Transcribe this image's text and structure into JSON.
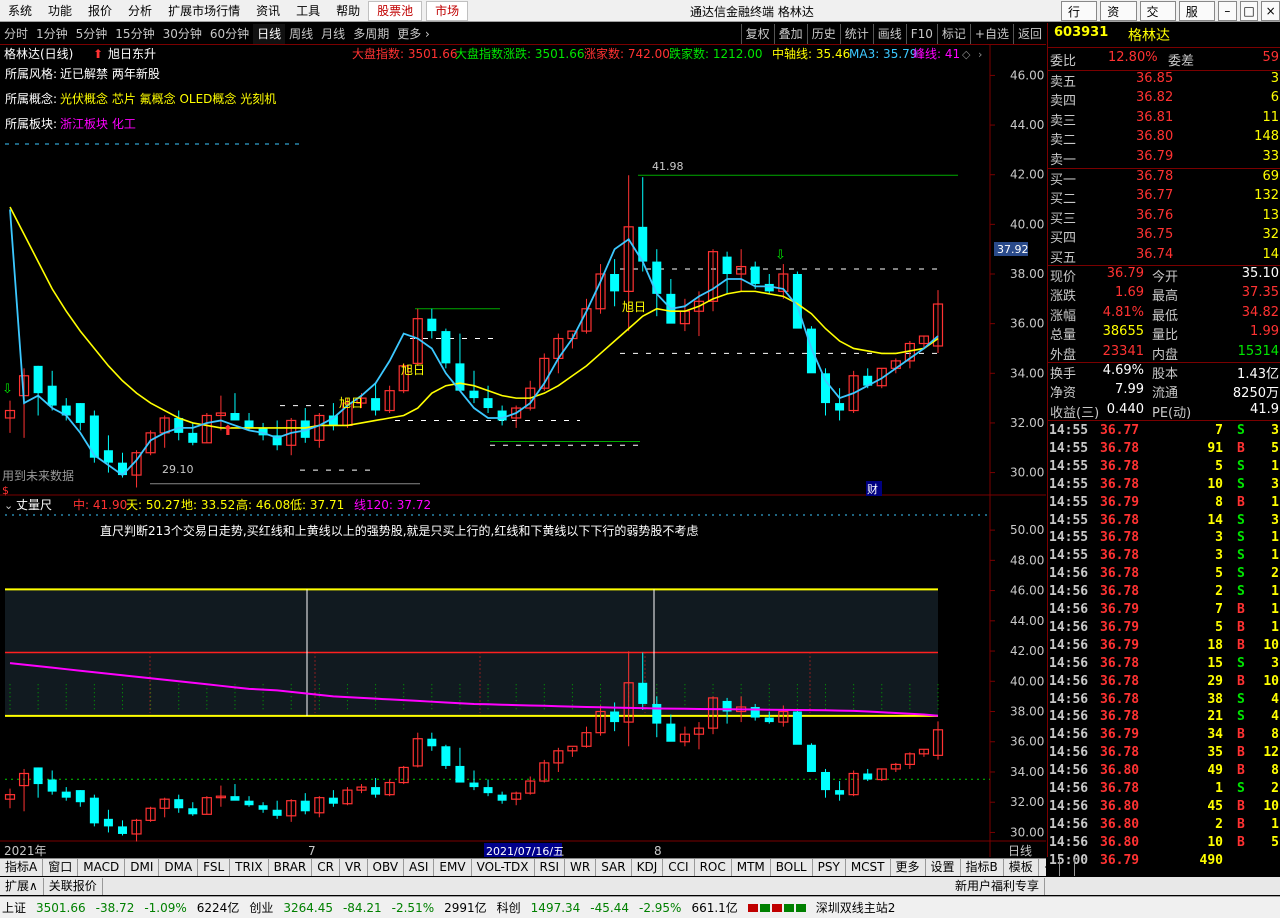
{
  "menu": {
    "items": [
      "系统",
      "功能",
      "报价",
      "分析",
      "扩展市场行情",
      "资讯",
      "工具",
      "帮助"
    ],
    "hl": [
      "股票池",
      "市场"
    ]
  },
  "app_title": "通达信金融终端  格林达",
  "win_buttons": [
    "行情",
    "资讯",
    "交易",
    "服务"
  ],
  "toolbar": {
    "periods": [
      "分时",
      "1分钟",
      "5分钟",
      "15分钟",
      "30分钟",
      "60分钟",
      "日线",
      "周线",
      "月线",
      "多周期",
      "更多 ›"
    ],
    "active": "日线",
    "actions": [
      "复权",
      "叠加",
      "历史",
      "统计",
      "画线",
      "F10",
      "标记",
      "+自选",
      "返回"
    ]
  },
  "main_info": {
    "title": "格林达(日线)",
    "signal": "旭日东升",
    "index_label": "大盘指数: 3501.66",
    "index_change_label": "大盘指数涨跌: 3501.66",
    "up_count_label": "涨家数: 742.00",
    "down_count_label": "跌家数: 1212.00",
    "mid_axis_label": "中轴线: 35.46",
    "ma3_label": "MA3: 35.79",
    "peak_label": "峰线: 41",
    "style_label": "所属风格:",
    "style_value": "近已解禁 两年新股",
    "concept_label": "所属概念:",
    "concept_value": "光伏概念 芯片 氟概念 OLED概念 光刻机",
    "sector_label": "所属板块:",
    "sector_value": "浙江板块 化工",
    "future_data": "用到未来数据",
    "high_mark": "41.98",
    "low_mark": "29.10",
    "xuri_label": "旭日",
    "cai_label": "财",
    "price_tag": "37.92"
  },
  "sub_info": {
    "title": "丈量尺",
    "zhong": "中: 41.90",
    "tian": "天: 50.27",
    "di": "地: 33.52",
    "gao": "高: 46.08",
    "di2": "低: 37.71",
    "xian120": "线120: 37.72",
    "desc": "直尺判断213个交易日走势,买红线和上黄线以上的强势股,就是只买上行的,红线和下黄线以下下行的弱势股不考虑"
  },
  "x_labels": [
    "2021年",
    "7",
    "8"
  ],
  "x_cursor_date": "2021/07/16/五",
  "y_axis_main": [
    "46.00",
    "44.00",
    "42.00",
    "40.00",
    "38.00",
    "36.00",
    "34.00",
    "32.00",
    "30.00"
  ],
  "y_axis_sub": [
    "50.00",
    "48.00",
    "46.00",
    "44.00",
    "42.00",
    "40.00",
    "38.00",
    "36.00",
    "34.00",
    "32.00",
    "30.00"
  ],
  "y_axis_unit": "日线",
  "right_panel": {
    "code": "603931",
    "name": "格林达",
    "weibi_label": "委比",
    "weibi": "12.80%",
    "weicha_label": "委差",
    "weicha": "59",
    "asks": [
      {
        "label": "卖五",
        "price": "36.85",
        "vol": "3"
      },
      {
        "label": "卖四",
        "price": "36.82",
        "vol": "6"
      },
      {
        "label": "卖三",
        "price": "36.81",
        "vol": "11"
      },
      {
        "label": "卖二",
        "price": "36.80",
        "vol": "148"
      },
      {
        "label": "卖一",
        "price": "36.79",
        "vol": "33"
      }
    ],
    "bids": [
      {
        "label": "买一",
        "price": "36.78",
        "vol": "69"
      },
      {
        "label": "买二",
        "price": "36.77",
        "vol": "132"
      },
      {
        "label": "买三",
        "price": "36.76",
        "vol": "13"
      },
      {
        "label": "买四",
        "price": "36.75",
        "vol": "32"
      },
      {
        "label": "买五",
        "price": "36.74",
        "vol": "14"
      }
    ],
    "stats1": [
      {
        "l1": "现价",
        "v1": "36.79",
        "c1": "red",
        "l2": "今开",
        "v2": "35.10",
        "c2": "white"
      },
      {
        "l1": "涨跌",
        "v1": "1.69",
        "c1": "red",
        "l2": "最高",
        "v2": "37.35",
        "c2": "red"
      },
      {
        "l1": "涨幅",
        "v1": "4.81%",
        "c1": "red",
        "l2": "最低",
        "v2": "34.82",
        "c2": "red"
      },
      {
        "l1": "总量",
        "v1": "38655",
        "c1": "yellow",
        "l2": "量比",
        "v2": "1.99",
        "c2": "red"
      },
      {
        "l1": "外盘",
        "v1": "23341",
        "c1": "red",
        "l2": "内盘",
        "v2": "15314",
        "c2": "green"
      }
    ],
    "stats2": [
      {
        "l1": "换手",
        "v1": "4.69%",
        "l2": "股本",
        "v2": "1.43亿"
      },
      {
        "l1": "净资",
        "v1": "7.99",
        "l2": "流通",
        "v2": "8250万"
      },
      {
        "l1": "收益(三)",
        "v1": "0.440",
        "l2": "PE(动)",
        "v2": "41.9"
      }
    ],
    "ticks": [
      {
        "t": "14:55",
        "p": "36.77",
        "v": "7",
        "s": "S",
        "n": "3"
      },
      {
        "t": "14:55",
        "p": "36.78",
        "v": "91",
        "s": "B",
        "n": "5"
      },
      {
        "t": "14:55",
        "p": "36.78",
        "v": "5",
        "s": "S",
        "n": "1"
      },
      {
        "t": "14:55",
        "p": "36.78",
        "v": "10",
        "s": "S",
        "n": "3"
      },
      {
        "t": "14:55",
        "p": "36.79",
        "v": "8",
        "s": "B",
        "n": "1"
      },
      {
        "t": "14:55",
        "p": "36.78",
        "v": "14",
        "s": "S",
        "n": "3"
      },
      {
        "t": "14:55",
        "p": "36.78",
        "v": "3",
        "s": "S",
        "n": "1"
      },
      {
        "t": "14:55",
        "p": "36.78",
        "v": "3",
        "s": "S",
        "n": "1"
      },
      {
        "t": "14:56",
        "p": "36.78",
        "v": "5",
        "s": "S",
        "n": "2"
      },
      {
        "t": "14:56",
        "p": "36.78",
        "v": "2",
        "s": "S",
        "n": "1"
      },
      {
        "t": "14:56",
        "p": "36.79",
        "v": "7",
        "s": "B",
        "n": "1"
      },
      {
        "t": "14:56",
        "p": "36.79",
        "v": "5",
        "s": "B",
        "n": "1"
      },
      {
        "t": "14:56",
        "p": "36.79",
        "v": "18",
        "s": "B",
        "n": "10"
      },
      {
        "t": "14:56",
        "p": "36.78",
        "v": "15",
        "s": "S",
        "n": "3"
      },
      {
        "t": "14:56",
        "p": "36.78",
        "v": "29",
        "s": "B",
        "n": "10"
      },
      {
        "t": "14:56",
        "p": "36.78",
        "v": "38",
        "s": "S",
        "n": "4"
      },
      {
        "t": "14:56",
        "p": "36.78",
        "v": "21",
        "s": "S",
        "n": "4"
      },
      {
        "t": "14:56",
        "p": "36.79",
        "v": "34",
        "s": "B",
        "n": "8"
      },
      {
        "t": "14:56",
        "p": "36.78",
        "v": "35",
        "s": "B",
        "n": "12"
      },
      {
        "t": "14:56",
        "p": "36.80",
        "v": "49",
        "s": "B",
        "n": "8"
      },
      {
        "t": "14:56",
        "p": "36.78",
        "v": "1",
        "s": "S",
        "n": "2"
      },
      {
        "t": "14:56",
        "p": "36.80",
        "v": "45",
        "s": "B",
        "n": "10"
      },
      {
        "t": "14:56",
        "p": "36.80",
        "v": "2",
        "s": "B",
        "n": "1"
      },
      {
        "t": "14:56",
        "p": "36.80",
        "v": "10",
        "s": "B",
        "n": "5"
      },
      {
        "t": "15:00",
        "p": "36.79",
        "v": "490",
        "s": "",
        "n": ""
      }
    ]
  },
  "bottom_tabs": [
    "指标A",
    "窗口",
    "MACD",
    "DMI",
    "DMA",
    "FSL",
    "TRIX",
    "BRAR",
    "CR",
    "VR",
    "OBV",
    "ASI",
    "EMV",
    "VOL-TDX",
    "RSI",
    "WR",
    "SAR",
    "KDJ",
    "CCI",
    "ROC",
    "MTM",
    "BOLL",
    "PSY",
    "MCST",
    "更多",
    "设置"
  ],
  "bottom_tabs_right": [
    "指标B",
    "模板",
    "+",
    "-"
  ],
  "bottom_tabs2": [
    "扩展∧",
    "关联报价"
  ],
  "bottom_tabs2_right": "新用户福利专享",
  "status": {
    "sh_label": "上证",
    "sh_val": "3501.66",
    "sh_chg": "-38.72",
    "sh_pct": "-1.09%",
    "sh_amt": "6224亿",
    "cy_label": "创业",
    "cy_val": "3264.45",
    "cy_chg": "-84.21",
    "cy_pct": "-2.51%",
    "cy_amt": "2991亿",
    "kc_label": "科创",
    "kc_val": "1497.34",
    "kc_chg": "-45.44",
    "kc_pct": "-2.95%",
    "kc_amt": "661.1亿",
    "server": "深圳双线主站2"
  },
  "colors": {
    "up": "#ff3232",
    "down": "#00ffff",
    "ma_yellow": "#ffff00",
    "ma_cyan": "#3cc8ff",
    "magenta": "#ff00ff",
    "grid": "#7a0000"
  },
  "chart_data": {
    "type": "candlestick",
    "ylim_main": [
      29.5,
      46.5
    ],
    "ylim_sub": [
      29.5,
      51
    ],
    "candles": [
      [
        32.2,
        32.9,
        31.6,
        32.5
      ],
      [
        33.1,
        34.2,
        31.4,
        33.9
      ],
      [
        34.3,
        34.3,
        32.3,
        33.2
      ],
      [
        33.5,
        34.1,
        32.5,
        32.7
      ],
      [
        32.7,
        33.0,
        32.1,
        32.3
      ],
      [
        32.8,
        32.8,
        31.7,
        32.0
      ],
      [
        32.3,
        32.5,
        30.4,
        30.6
      ],
      [
        30.9,
        31.5,
        30.0,
        30.4
      ],
      [
        30.4,
        30.8,
        29.8,
        29.9
      ],
      [
        29.9,
        30.9,
        29.4,
        30.8
      ],
      [
        30.8,
        31.7,
        30.7,
        31.6
      ],
      [
        31.6,
        32.3,
        31.0,
        32.2
      ],
      [
        32.2,
        32.5,
        31.3,
        31.6
      ],
      [
        31.6,
        32.0,
        31.1,
        31.2
      ],
      [
        31.2,
        32.4,
        31.2,
        32.3
      ],
      [
        32.3,
        33.1,
        31.7,
        32.4
      ],
      [
        32.4,
        33.2,
        32.2,
        32.1
      ],
      [
        32.1,
        32.4,
        31.7,
        31.8
      ],
      [
        31.8,
        32.0,
        31.3,
        31.5
      ],
      [
        31.5,
        32.1,
        30.9,
        31.1
      ],
      [
        31.1,
        32.2,
        30.7,
        32.1
      ],
      [
        32.1,
        32.6,
        31.2,
        31.4
      ],
      [
        31.3,
        32.4,
        31.0,
        32.3
      ],
      [
        32.3,
        32.8,
        31.7,
        31.9
      ],
      [
        31.9,
        33.0,
        31.8,
        32.8
      ],
      [
        32.8,
        33.2,
        32.6,
        33.0
      ],
      [
        33.0,
        33.6,
        32.3,
        32.5
      ],
      [
        32.5,
        33.5,
        32.4,
        33.3
      ],
      [
        33.3,
        34.4,
        33.2,
        34.3
      ],
      [
        34.4,
        36.6,
        34.3,
        36.2
      ],
      [
        36.2,
        36.6,
        35.4,
        35.7
      ],
      [
        35.7,
        35.8,
        34.2,
        34.4
      ],
      [
        34.4,
        35.6,
        34.3,
        33.3
      ],
      [
        33.3,
        34.1,
        32.8,
        33.0
      ],
      [
        33.0,
        33.5,
        32.4,
        32.6
      ],
      [
        32.5,
        32.7,
        31.9,
        32.1
      ],
      [
        32.2,
        32.7,
        31.8,
        32.6
      ],
      [
        32.6,
        33.7,
        32.5,
        33.4
      ],
      [
        33.4,
        34.8,
        33.3,
        34.6
      ],
      [
        34.6,
        35.6,
        34.0,
        35.4
      ],
      [
        35.4,
        35.6,
        35.0,
        35.7
      ],
      [
        35.7,
        37.0,
        35.6,
        36.6
      ],
      [
        36.6,
        38.4,
        36.4,
        38.0
      ],
      [
        38.0,
        38.6,
        36.7,
        37.3
      ],
      [
        37.3,
        41.98,
        35.7,
        39.9
      ],
      [
        39.9,
        41.9,
        38.1,
        38.5
      ],
      [
        38.5,
        39.0,
        36.3,
        37.2
      ],
      [
        37.2,
        37.8,
        36.3,
        36.0
      ],
      [
        36.0,
        37.0,
        35.7,
        36.5
      ],
      [
        36.5,
        37.3,
        35.5,
        36.9
      ],
      [
        36.9,
        39.0,
        36.5,
        38.9
      ],
      [
        38.7,
        38.9,
        37.2,
        38.0
      ],
      [
        38.0,
        39.0,
        37.3,
        38.3
      ],
      [
        38.3,
        38.5,
        37.4,
        37.6
      ],
      [
        37.6,
        38.0,
        37.2,
        37.3
      ],
      [
        37.3,
        38.4,
        37.0,
        38.0
      ],
      [
        38.0,
        38.1,
        36.2,
        35.8
      ],
      [
        35.8,
        35.9,
        34.2,
        34.0
      ],
      [
        34.0,
        34.2,
        32.3,
        32.8
      ],
      [
        32.8,
        33.4,
        32.1,
        32.5
      ],
      [
        32.5,
        34.1,
        32.4,
        33.9
      ],
      [
        33.9,
        34.2,
        33.4,
        33.5
      ],
      [
        33.5,
        34.2,
        33.4,
        34.2
      ],
      [
        34.2,
        34.6,
        34.0,
        34.5
      ],
      [
        34.5,
        35.3,
        34.2,
        35.2
      ],
      [
        35.2,
        35.5,
        35.0,
        35.5
      ],
      [
        35.1,
        37.35,
        34.82,
        36.79
      ]
    ],
    "ma3": [
      40.7,
      39.6,
      38.5,
      37.4,
      36.5,
      35.7,
      35.0,
      34.3,
      33.7,
      33.2,
      32.8,
      32.5,
      32.2,
      32.0,
      31.9,
      31.8,
      31.8,
      31.8,
      31.8,
      31.8,
      31.8,
      31.8,
      31.9,
      31.9,
      31.9,
      32.0,
      32.1,
      32.2,
      32.3,
      32.6,
      33.2,
      33.5,
      33.6,
      33.5,
      33.3,
      33.1,
      33.0,
      33.0,
      33.2,
      33.5,
      33.9,
      34.3,
      34.8,
      35.3,
      35.8,
      36.3,
      36.6,
      36.5,
      36.5,
      36.7,
      37.0,
      37.2,
      37.3,
      37.3,
      37.2,
      37.1,
      36.8,
      36.4,
      35.8,
      35.3,
      35.0,
      34.9,
      34.8,
      34.8,
      34.9,
      35.0,
      35.4
    ],
    "ma_cyan": [
      40.6,
      32.8,
      33.1,
      32.6,
      32.3,
      31.6,
      30.7,
      30.3,
      29.9,
      30.5,
      31.3,
      31.6,
      31.8,
      31.8,
      32.0,
      32.1,
      31.9,
      31.7,
      31.6,
      31.4,
      31.6,
      31.7,
      31.9,
      32.2,
      32.7,
      33.1,
      33.6,
      34.5,
      35.6,
      35.4,
      35.0,
      34.0,
      33.3,
      32.6,
      32.2,
      32.2,
      32.4,
      32.8,
      33.6,
      34.6,
      35.4,
      36.5,
      37.7,
      39.0,
      39.4,
      38.5,
      37.2,
      36.6,
      36.7,
      37.1,
      37.4,
      37.8,
      37.8,
      37.5,
      37.5,
      37.4,
      36.7,
      35.0,
      33.7,
      33.0,
      33.2,
      33.5,
      33.8,
      34.2,
      34.6,
      35.0,
      35.5
    ],
    "sub_line": [
      41.2,
      41.1,
      41.0,
      40.9,
      40.8,
      40.7,
      40.6,
      40.5,
      40.4,
      40.3,
      40.2,
      40.1,
      40.0,
      39.9,
      39.8,
      39.7,
      39.6,
      39.5,
      39.45,
      39.4,
      39.3,
      39.2,
      39.1,
      39.0,
      38.95,
      38.9,
      38.85,
      38.8,
      38.75,
      38.7,
      38.65,
      38.6,
      38.55,
      38.5,
      38.48,
      38.45,
      38.42,
      38.4,
      38.38,
      38.35,
      38.32,
      38.3,
      38.28,
      38.26,
      38.24,
      38.22,
      38.2,
      38.19,
      38.18,
      38.17,
      38.16,
      38.15,
      38.14,
      38.13,
      38.12,
      38.11,
      38.1,
      38.09,
      38.08,
      38.06,
      38.04,
      38.0,
      37.95,
      37.9,
      37.85,
      37.8,
      37.72
    ]
  }
}
